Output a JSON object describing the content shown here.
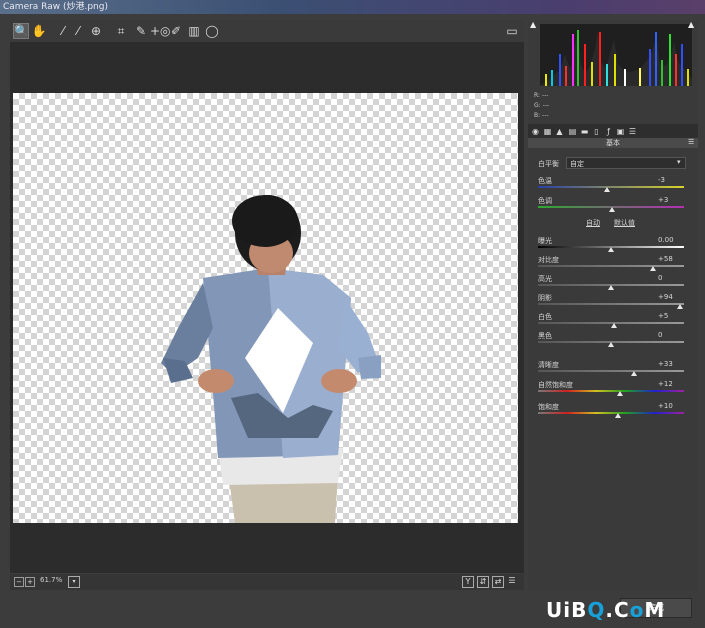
{
  "window": {
    "title": "Camera Raw (炒港.png)"
  },
  "toolbar": {
    "tools": [
      {
        "icon": "zoom-icon",
        "glyph": "🔍",
        "selected": true
      },
      {
        "icon": "hand-icon",
        "glyph": "✋"
      },
      {
        "icon": "white-balance-icon",
        "glyph": "⁄"
      },
      {
        "icon": "color-sampler-icon",
        "glyph": "⁄"
      },
      {
        "icon": "targeted-adjustment-icon",
        "glyph": "⊕"
      },
      {
        "icon": "crop-icon",
        "glyph": "⌗"
      },
      {
        "icon": "spot-removal-icon",
        "glyph": "✎"
      },
      {
        "icon": "red-eye-icon",
        "glyph": "+◎"
      },
      {
        "icon": "adjustment-brush-icon",
        "glyph": "✐"
      },
      {
        "icon": "graduated-filter-icon",
        "glyph": "▥"
      },
      {
        "icon": "radial-filter-icon",
        "glyph": "◯"
      }
    ],
    "fullscreen_icon": "▭"
  },
  "zoom": {
    "value": "61.7%"
  },
  "histogram": {
    "r": "R: ---",
    "g": "G: ---",
    "b": "B: ---"
  },
  "panel": {
    "section_title": "基本"
  },
  "white_balance": {
    "label": "白平衡",
    "value": "自定"
  },
  "auto_links": {
    "auto": "自动",
    "default": "默认值"
  },
  "sliders": [
    {
      "key": "temp",
      "label": "色温",
      "value": "-3",
      "pos": 0.47,
      "track": "linear-gradient(90deg,#2a3fa8,#d8d22a)"
    },
    {
      "key": "tint",
      "label": "色调",
      "value": "+3",
      "pos": 0.51,
      "track": "linear-gradient(90deg,#2fa82f,#b42fb4)"
    },
    {
      "key": "exposure",
      "label": "曝光",
      "value": "0.00",
      "pos": 0.5,
      "track": "linear-gradient(90deg,#000,#fff)"
    },
    {
      "key": "contrast",
      "label": "对比度",
      "value": "+58",
      "pos": 0.79,
      "track": "linear-gradient(90deg,#555,#999)"
    },
    {
      "key": "highlights",
      "label": "高光",
      "value": "0",
      "pos": 0.5,
      "track": "linear-gradient(90deg,#555,#999)"
    },
    {
      "key": "shadows",
      "label": "阴影",
      "value": "+94",
      "pos": 0.97,
      "track": "linear-gradient(90deg,#555,#999)"
    },
    {
      "key": "whites",
      "label": "白色",
      "value": "+5",
      "pos": 0.52,
      "track": "linear-gradient(90deg,#555,#999)"
    },
    {
      "key": "blacks",
      "label": "黑色",
      "value": "0",
      "pos": 0.5,
      "track": "linear-gradient(90deg,#555,#999)"
    },
    {
      "key": "clarity",
      "label": "清晰度",
      "value": "+33",
      "pos": 0.66,
      "track": "linear-gradient(90deg,#555,#999)"
    },
    {
      "key": "vibrance",
      "label": "自然饱和度",
      "value": "+12",
      "pos": 0.56,
      "track": "linear-gradient(90deg,#777,#d02020,#d0c020,#20a020,#2020d0,#a020a0)"
    },
    {
      "key": "saturation",
      "label": "饱和度",
      "value": "+10",
      "pos": 0.55,
      "track": "linear-gradient(90deg,#777,#d02020,#d0c020,#20a020,#2020d0,#a020a0)"
    }
  ],
  "footer": {
    "done": "完成"
  },
  "watermark": {
    "text": "UiBQ.CoM"
  }
}
